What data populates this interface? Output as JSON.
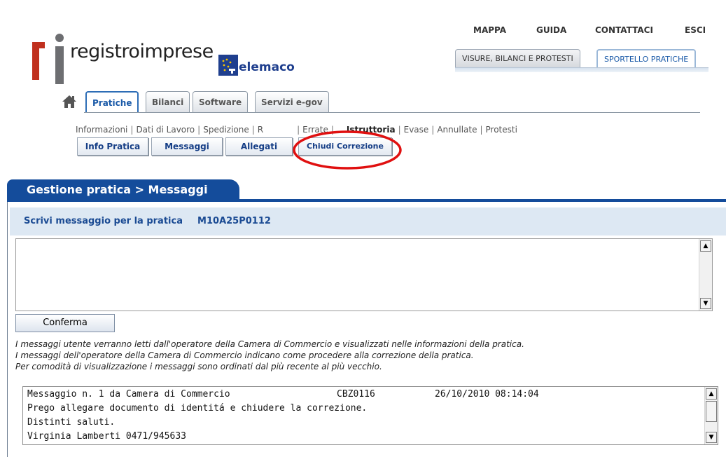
{
  "brand": {
    "logo_text": "registroimprese",
    "telemaco_text": "elemaco",
    "colors": {
      "logo_red": "#c0301e",
      "logo_gray": "#6d6e71",
      "accent_blue": "#144c9b",
      "annotation_red": "#e01010"
    }
  },
  "top_links": [
    "MAPPA",
    "GUIDA",
    "CONTATTACI",
    "ESCI"
  ],
  "top_tabs": [
    "VISURE, BILANCI E PROTESTI",
    "SPORTELLO PRATICHE"
  ],
  "nav_tabs": [
    "Pratiche",
    "Bilanci",
    "Software",
    "Servizi e-gov"
  ],
  "sub_links": {
    "items": [
      "Informazioni",
      "Dati di Lavoro",
      "Spedizione",
      "Ricerca",
      "Errate",
      "In Istruttoria",
      "Evase",
      "Annullate",
      "Protesti"
    ],
    "visible_text": [
      "Informazioni",
      "Dati di Lavoro",
      "Spedizione",
      "R",
      "Errate",
      "Istruttoria",
      "Evase",
      "Annullate",
      "Protesti"
    ]
  },
  "action_buttons": [
    "Info Pratica",
    "Messaggi",
    "Allegati",
    "Chiudi Correzione"
  ],
  "section": {
    "title": "Gestione pratica > Messaggi",
    "write_label": "Scrivi messaggio per la pratica",
    "pratica_code": "M10A25P0112"
  },
  "message_input": {
    "value": ""
  },
  "confirm_label": "Conferma",
  "notes": [
    "I messaggi utente verranno letti dall'operatore della Camera di Commercio e visualizzati nelle informazioni della pratica.",
    "I messaggi dell'operatore della Camera di Commercio indicano come procedere alla correzione della pratica.",
    "Per comodità di visualizzazione i messaggi sono ordinati dal più recente al più vecchio."
  ],
  "messages": {
    "header": {
      "title": "Messaggio n. 1 da Camera di Commercio",
      "code": "CBZ0116",
      "datetime": "26/10/2010 08:14:04"
    },
    "lines": [
      "Prego allegare documento di identitá e chiudere la correzione.",
      "Distinti saluti.",
      "Virginia Lamberti 0471/945633"
    ]
  },
  "icons": [
    "home-icon",
    "scroll-up-arrow-icon",
    "scroll-down-arrow-icon"
  ]
}
